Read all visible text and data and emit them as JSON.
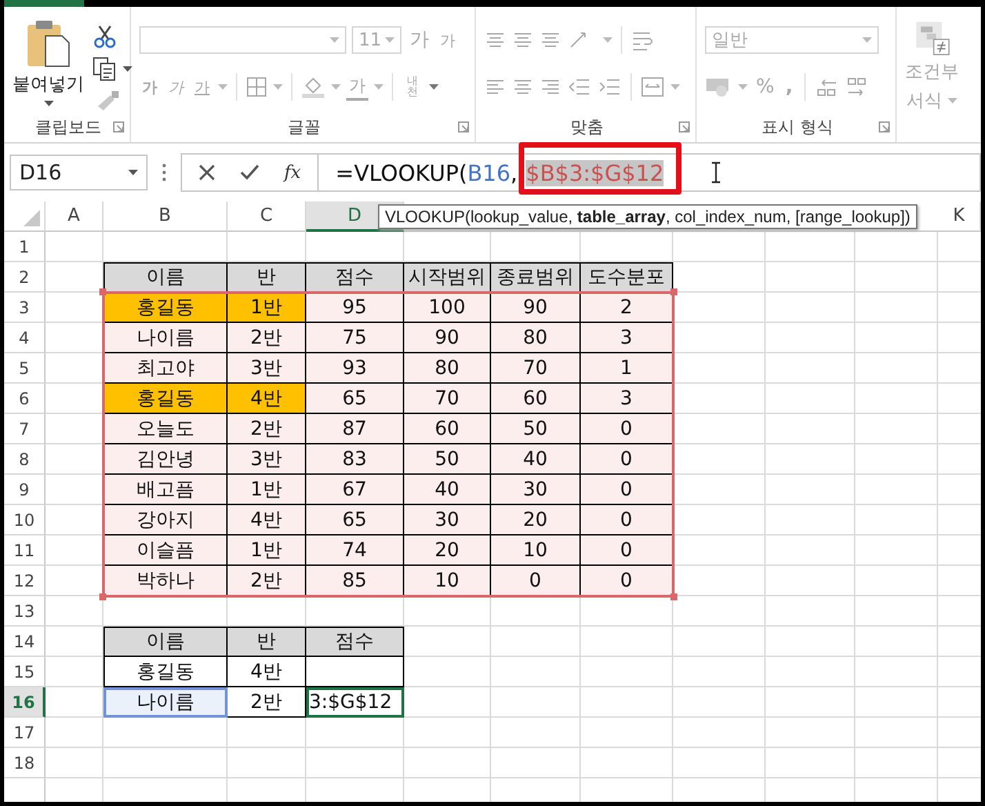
{
  "ribbon": {
    "groups": [
      {
        "kind": "clipboard",
        "label": "클립보드",
        "paste_label": "붙여넣기",
        "disabled": false,
        "painter_disabled": true
      },
      {
        "kind": "font",
        "label": "글꼴",
        "font_size": "11",
        "grow": "가",
        "shrink": "가",
        "bold": "가",
        "italic": "가",
        "underline": "가",
        "font_color": "가",
        "phonetic": "내천",
        "disabled": true
      },
      {
        "kind": "alignment",
        "label": "맞춤",
        "disabled": true
      },
      {
        "kind": "number",
        "label": "표시 형식",
        "format": "일반",
        "percent": "%",
        "comma": ",",
        "disabled": true
      },
      {
        "kind": "styles",
        "conditional_line1": "조건부",
        "conditional_line2": "서식",
        "disabled": true
      }
    ]
  },
  "formula_bar": {
    "name_box": "D16",
    "function_label": "fx",
    "range_boxed": true,
    "parts": [
      {
        "kind": "text",
        "text": "=VLOOKUP("
      },
      {
        "kind": "ref",
        "text": "B16"
      },
      {
        "kind": "text",
        "text": ","
      },
      {
        "kind": "range",
        "text": "$B$3:$G$12"
      }
    ],
    "tooltip": "VLOOKUP(lookup_value, **table_array**, col_index_num, [range_lookup])"
  },
  "columns": [
    {
      "label": "A",
      "selected": false
    },
    {
      "label": "B",
      "selected": false
    },
    {
      "label": "C",
      "selected": false
    },
    {
      "label": "D",
      "selected": true
    },
    {
      "label": "K",
      "selected": false
    }
  ],
  "row_numbers": [
    {
      "label": "1",
      "selected": false
    },
    {
      "label": "2",
      "selected": false
    },
    {
      "label": "3",
      "selected": false
    },
    {
      "label": "4",
      "selected": false
    },
    {
      "label": "5",
      "selected": false
    },
    {
      "label": "6",
      "selected": false
    },
    {
      "label": "7",
      "selected": false
    },
    {
      "label": "8",
      "selected": false
    },
    {
      "label": "9",
      "selected": false
    },
    {
      "label": "10",
      "selected": false
    },
    {
      "label": "11",
      "selected": false
    },
    {
      "label": "12",
      "selected": false
    },
    {
      "label": "13",
      "selected": false
    },
    {
      "label": "14",
      "selected": false
    },
    {
      "label": "15",
      "selected": false
    },
    {
      "label": "16",
      "selected": true
    },
    {
      "label": "17",
      "selected": false
    },
    {
      "label": "18",
      "selected": false
    }
  ],
  "table1": {
    "referenced": true,
    "columns": [
      "이름",
      "반",
      "점수",
      "시작범위",
      "종료범위",
      "도수분포"
    ],
    "rows": [
      {
        "cells": [
          "홍길동",
          "1반",
          "95",
          "100",
          "90",
          "2"
        ],
        "highlighted": true
      },
      {
        "cells": [
          "나이름",
          "2반",
          "75",
          "90",
          "80",
          "3"
        ],
        "highlighted": false
      },
      {
        "cells": [
          "최고야",
          "3반",
          "93",
          "80",
          "70",
          "1"
        ],
        "highlighted": false
      },
      {
        "cells": [
          "홍길동",
          "4반",
          "65",
          "70",
          "60",
          "3"
        ],
        "highlighted": true
      },
      {
        "cells": [
          "오늘도",
          "2반",
          "87",
          "60",
          "50",
          "0"
        ],
        "highlighted": false
      },
      {
        "cells": [
          "김안녕",
          "3반",
          "83",
          "50",
          "40",
          "0"
        ],
        "highlighted": false
      },
      {
        "cells": [
          "배고픔",
          "1반",
          "67",
          "40",
          "30",
          "0"
        ],
        "highlighted": false
      },
      {
        "cells": [
          "강아지",
          "4반",
          "65",
          "30",
          "20",
          "0"
        ],
        "highlighted": false
      },
      {
        "cells": [
          "이슬픔",
          "1반",
          "74",
          "20",
          "10",
          "0"
        ],
        "highlighted": false
      },
      {
        "cells": [
          "박하나",
          "2반",
          "85",
          "10",
          "0",
          "0"
        ],
        "highlighted": false
      }
    ]
  },
  "table2": {
    "columns": [
      "이름",
      "반",
      "점수"
    ],
    "rows": [
      {
        "name": "홍길동",
        "class": "4반",
        "referenced": false,
        "active": false
      },
      {
        "name": "나이름",
        "class": "2반",
        "score": "3:$G$12",
        "referenced": true,
        "active": true
      }
    ]
  }
}
